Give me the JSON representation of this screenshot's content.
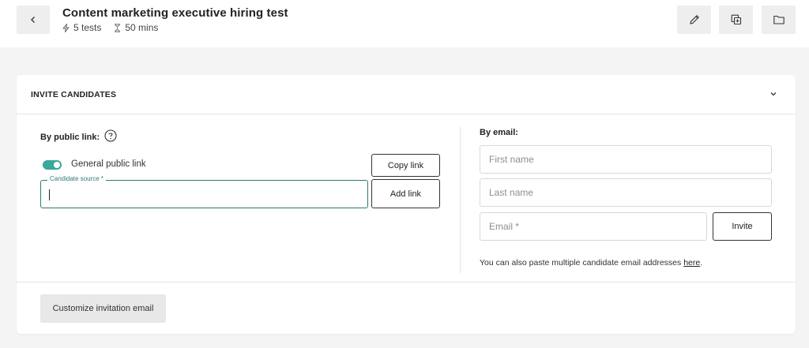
{
  "header": {
    "title": "Content marketing executive hiring test",
    "tests_count": "5 tests",
    "duration": "50 mins",
    "back_icon": "chevron-left-icon",
    "actions": [
      "pencil-icon",
      "duplicate-icon",
      "folder-icon"
    ]
  },
  "invite": {
    "title": "INVITE CANDIDATES",
    "public_link": {
      "label": "By public link:",
      "toggle_label": "General public link",
      "toggle_on": true,
      "copy_link_label": "Copy link",
      "source_field_label": "Candidate source *",
      "source_value": "",
      "add_link_label": "Add link"
    },
    "email": {
      "label": "By email:",
      "first_name_placeholder": "First name",
      "last_name_placeholder": "Last name",
      "email_placeholder": "Email *",
      "invite_label": "Invite",
      "paste_note_prefix": "You can also paste multiple candidate email addresses ",
      "paste_note_link": "here",
      "paste_note_suffix": "."
    },
    "customize_label": "Customize invitation email"
  },
  "colors": {
    "accent": "#3aa89a",
    "field_border": "#2e7a72",
    "page_bg": "#f3f4f3"
  }
}
